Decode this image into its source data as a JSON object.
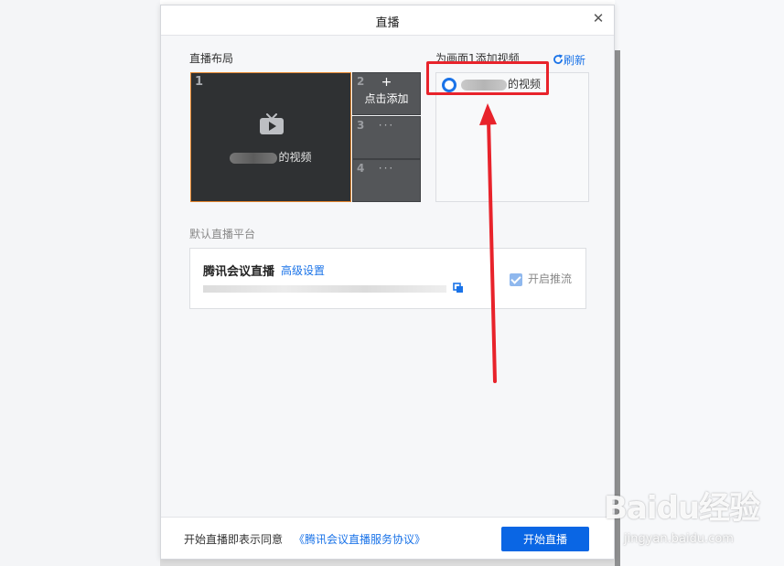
{
  "dialog": {
    "title": "直播",
    "close_symbol": "✕"
  },
  "layout": {
    "label": "直播布局",
    "main": {
      "number": "1",
      "caption_suffix": "的视频"
    },
    "side": [
      {
        "number": "2",
        "plus": "+",
        "text": "点击添加"
      },
      {
        "number": "3",
        "dots": "···"
      },
      {
        "number": "4",
        "dots": "···"
      }
    ]
  },
  "video_source": {
    "label": "为画面1添加视频",
    "refresh_label": "刷新",
    "option_suffix": "的视频"
  },
  "platform": {
    "label": "默认直播平台",
    "name": "腾讯会议直播",
    "advanced_link": "高级设置",
    "push_label": "开启推流",
    "push_checked": true
  },
  "footer": {
    "agree_text": "开始直播即表示同意",
    "agree_link": "《腾讯会议直播服务协议》",
    "start_button": "开始直播"
  },
  "watermark": {
    "logo": "Baidu经验",
    "url": "jingyan.baidu.com"
  },
  "colors": {
    "accent": "#1a73e8",
    "selected_border": "#e5862d",
    "annotation": "#e8232b"
  }
}
